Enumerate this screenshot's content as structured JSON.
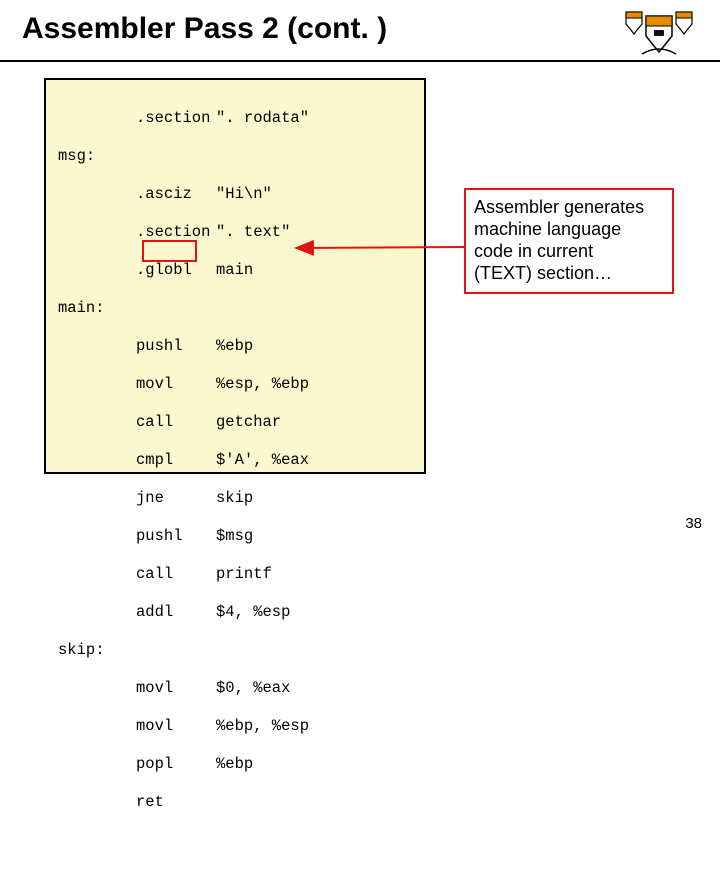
{
  "title": "Assembler Pass 2 (cont. )",
  "crest_name": "princeton-crest",
  "code": {
    "l0": {
      "label": "",
      "mn": ".section",
      "op": "\". rodata\""
    },
    "l1": {
      "label": "msg:",
      "mn": "",
      "op": ""
    },
    "l2": {
      "label": "",
      "mn": ".asciz",
      "op": "\"Hi\\n\""
    },
    "l3": {
      "label": "",
      "mn": ".section",
      "op": "\". text\""
    },
    "l4": {
      "label": "",
      "mn": ".globl",
      "op": "main"
    },
    "l5": {
      "label": "main:",
      "mn": "",
      "op": ""
    },
    "l6": {
      "label": "",
      "mn": "pushl",
      "op": "%ebp"
    },
    "l7": {
      "label": "",
      "mn": "movl",
      "op": "%esp, %ebp"
    },
    "l8": {
      "label": "",
      "mn": "call",
      "op": "getchar"
    },
    "l9": {
      "label": "",
      "mn": "cmpl",
      "op": "$'A', %eax"
    },
    "l10": {
      "label": "",
      "mn": "jne",
      "op": "skip"
    },
    "l11": {
      "label": "",
      "mn": "pushl",
      "op": "$msg"
    },
    "l12": {
      "label": "",
      "mn": "call",
      "op": "printf"
    },
    "l13": {
      "label": "",
      "mn": "addl",
      "op": "$4, %esp"
    },
    "l14": {
      "label": "skip:",
      "mn": "",
      "op": ""
    },
    "l15": {
      "label": "",
      "mn": "movl",
      "op": "$0, %eax"
    },
    "l16": {
      "label": "",
      "mn": "movl",
      "op": "%ebp, %esp"
    },
    "l17": {
      "label": "",
      "mn": "popl",
      "op": "%ebp"
    },
    "l18": {
      "label": "",
      "mn": "ret",
      "op": ""
    }
  },
  "callout": {
    "line1": "Assembler generates",
    "line2": "machine language",
    "line3": "code in current",
    "line4": "(TEXT) section…"
  },
  "pagenum": "38"
}
